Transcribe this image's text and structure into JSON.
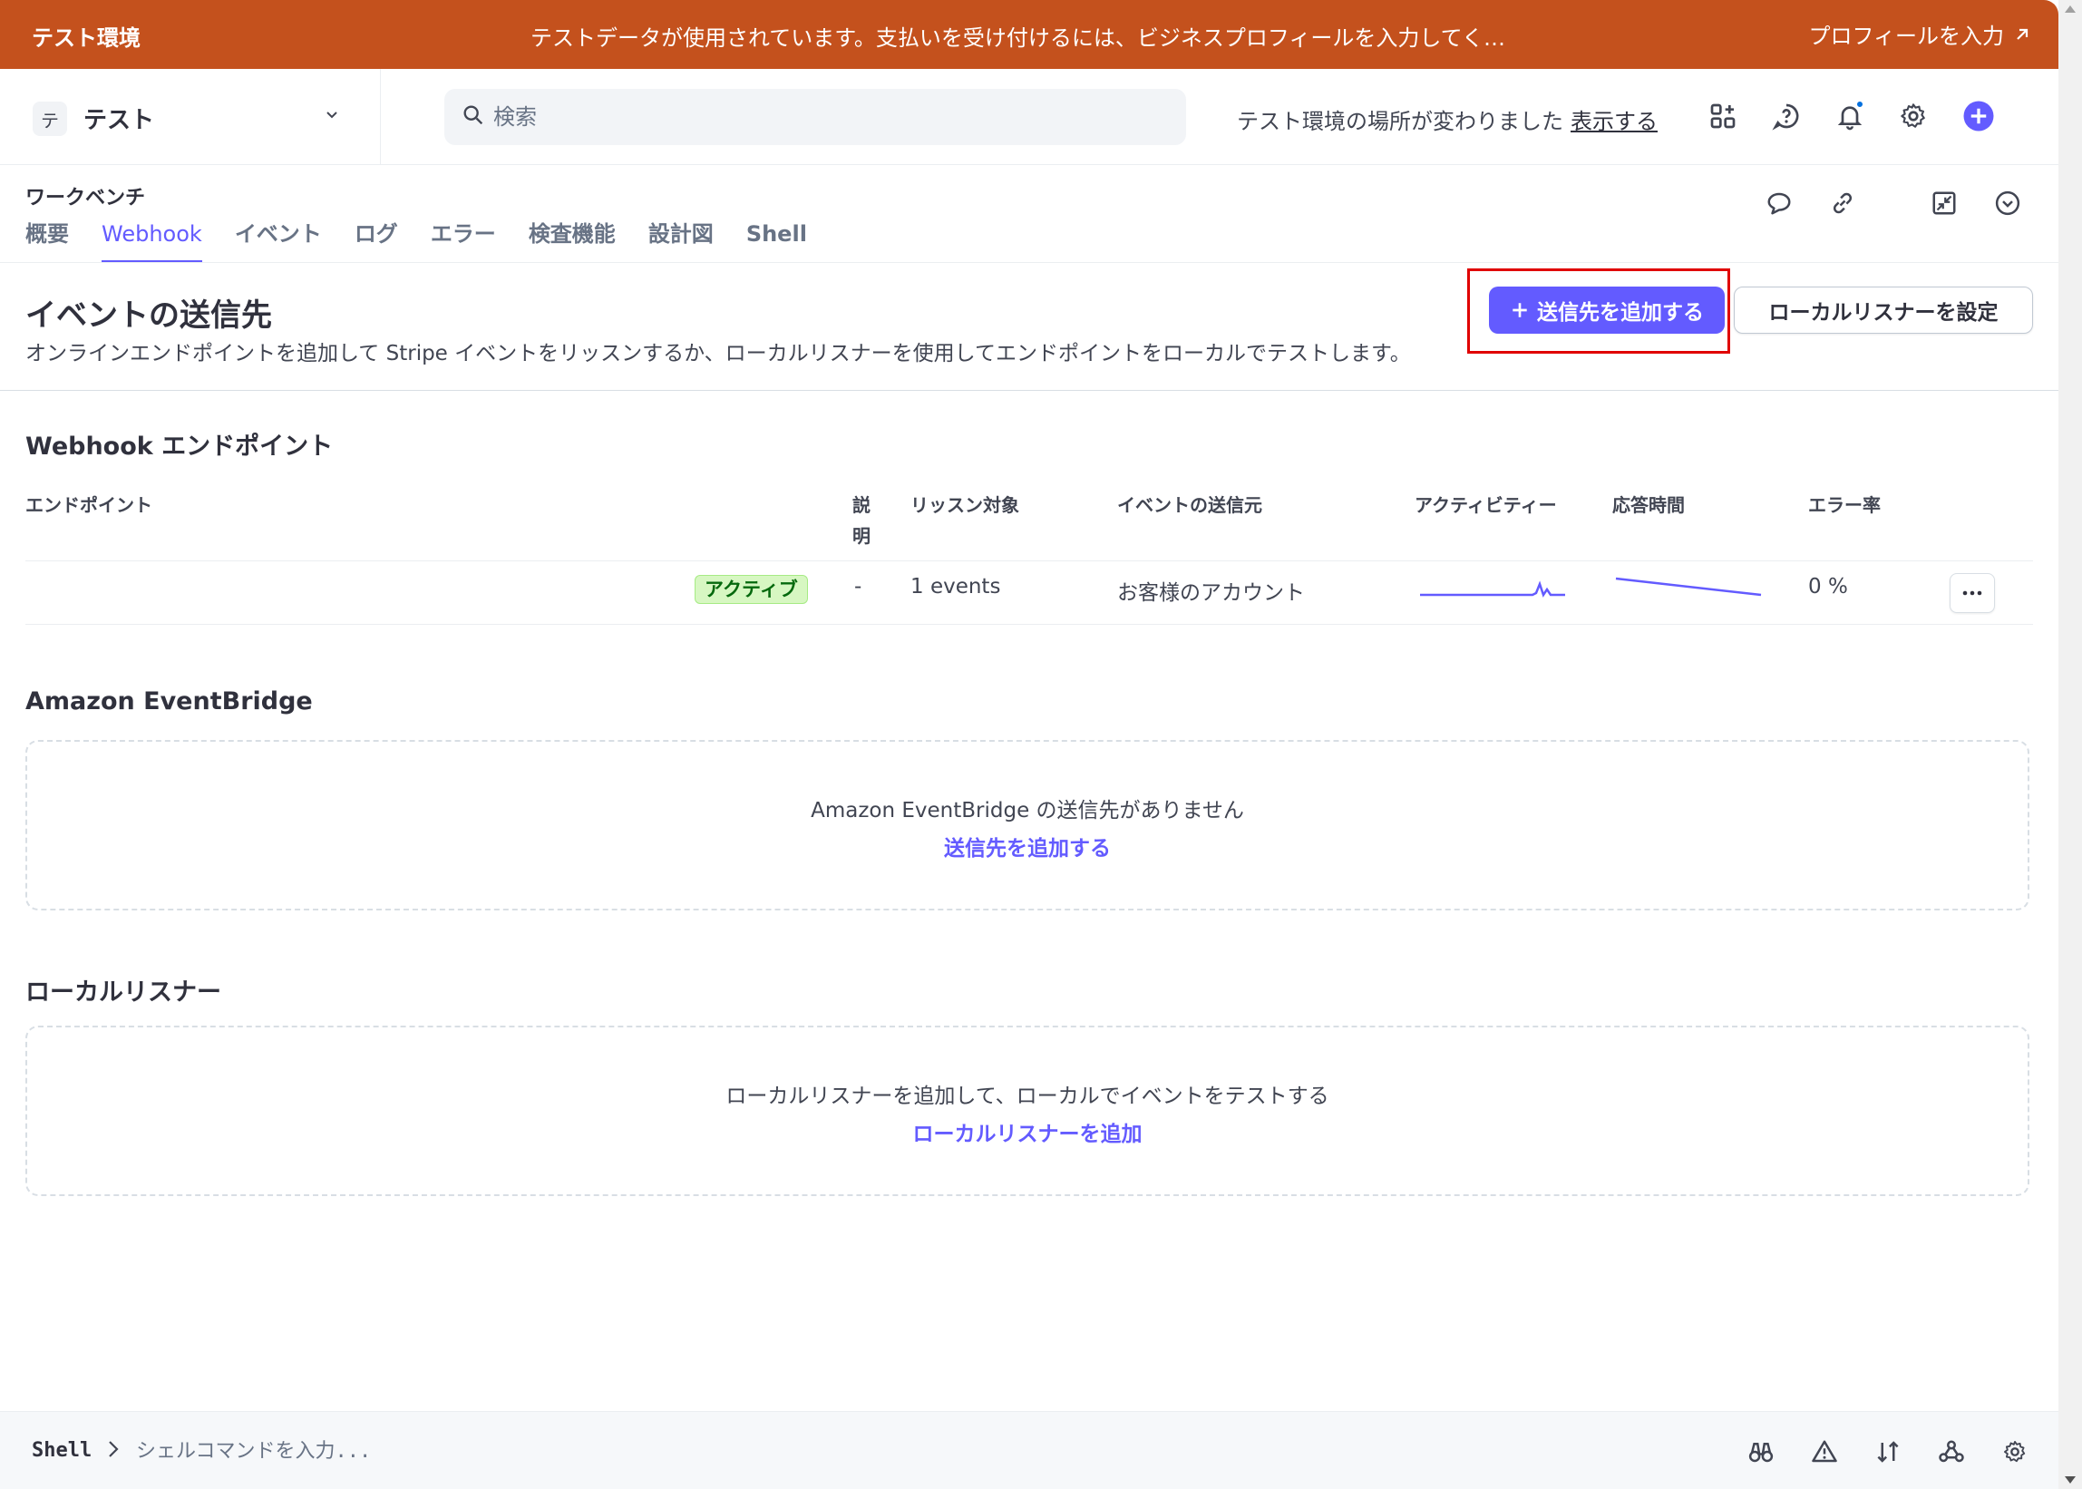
{
  "banner": {
    "env_label": "テスト環境",
    "message": "テストデータが使用されています。支払いを受け付けるには、ビジネスプロフィールを入力してく…",
    "cta": "プロフィールを入力"
  },
  "topbar": {
    "account_badge": "テ",
    "account_name": "テスト",
    "search_placeholder": "検索",
    "env_note": "テスト環境の場所が変わりました",
    "env_note_link": "表示する"
  },
  "workbench": {
    "title": "ワークベンチ",
    "tabs": [
      {
        "label": "概要",
        "active": false
      },
      {
        "label": "Webhook",
        "active": true
      },
      {
        "label": "イベント",
        "active": false
      },
      {
        "label": "ログ",
        "active": false
      },
      {
        "label": "エラー",
        "active": false
      },
      {
        "label": "検査機能",
        "active": false
      },
      {
        "label": "設計図",
        "active": false
      },
      {
        "label": "Shell",
        "active": false
      }
    ]
  },
  "page": {
    "title": "イベントの送信先",
    "subtitle": "オンラインエンドポイントを追加して Stripe イベントをリッスンするか、ローカルリスナーを使用してエンドポイントをローカルでテストします。",
    "add_button": "送信先を追加する",
    "local_button": "ローカルリスナーを設定"
  },
  "webhooks": {
    "title": "Webhook エンドポイント",
    "columns": {
      "endpoint": "エンドポイント",
      "description": "説明",
      "listen": "リッスン対象",
      "source": "イベントの送信元",
      "activity": "アクティビティー",
      "response": "応答時間",
      "error": "エラー率"
    },
    "rows": [
      {
        "status": "アクティブ",
        "description": "-",
        "listen": "1 events",
        "source": "お客様のアカウント",
        "error": "0 %"
      }
    ]
  },
  "eventbridge": {
    "title": "Amazon EventBridge",
    "empty_text": "Amazon EventBridge の送信先がありません",
    "empty_link": "送信先を追加する"
  },
  "local": {
    "title": "ローカルリスナー",
    "empty_text": "ローカルリスナーを追加して、ローカルでイベントをテストする",
    "empty_link": "ローカルリスナーを追加"
  },
  "shell": {
    "label": "Shell",
    "placeholder": "シェルコマンドを入力..."
  },
  "colors": {
    "banner": "#c4511d",
    "accent": "#635bff",
    "active_pill": "#d7f7c2",
    "highlight": "#e00000"
  }
}
